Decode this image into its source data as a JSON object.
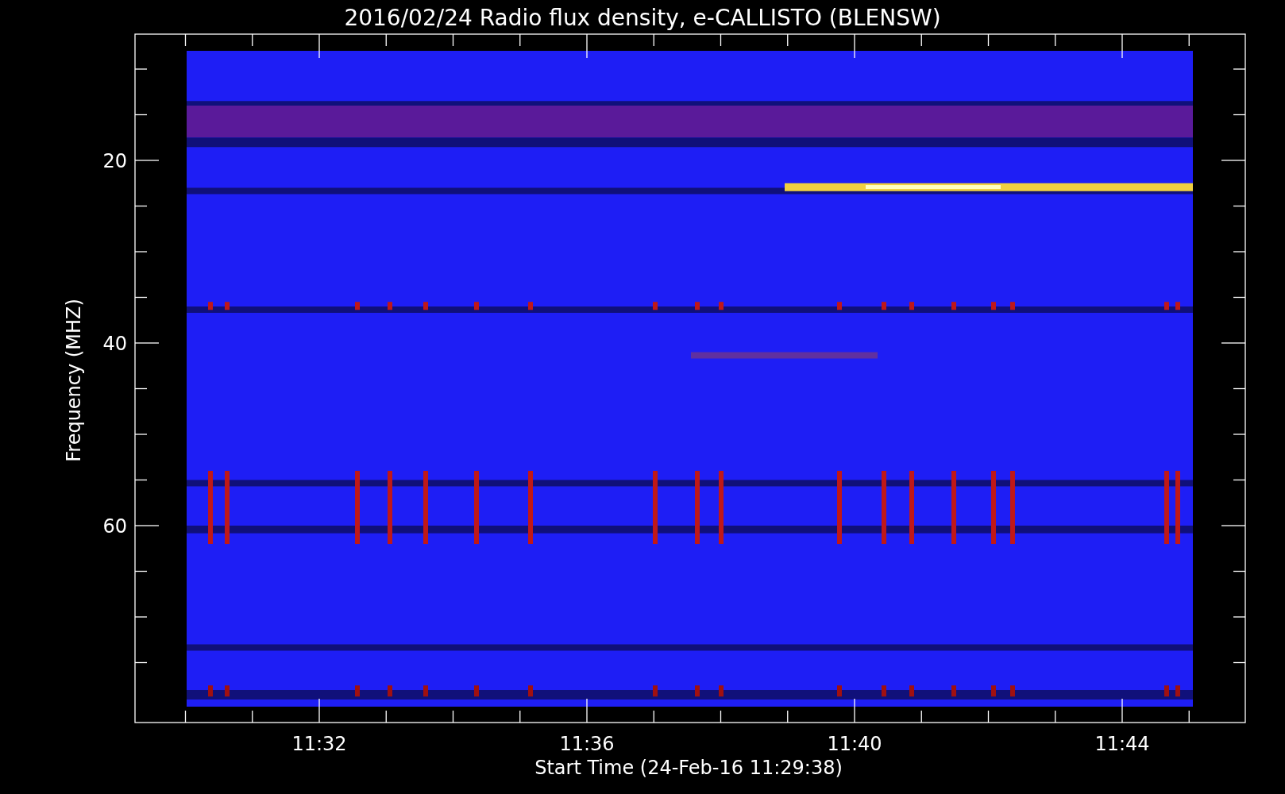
{
  "title": "2016/02/24  Radio flux density, e-CALLISTO (BLENSW)",
  "plot": {
    "ylabel": "Frequency (MHZ)",
    "xlabel": "Start Time (24-Feb-16 11:29:38)",
    "yticks": [
      "20",
      "40",
      "60"
    ],
    "xticks": [
      "11:32",
      "11:36",
      "11:40",
      "11:44"
    ]
  }
}
